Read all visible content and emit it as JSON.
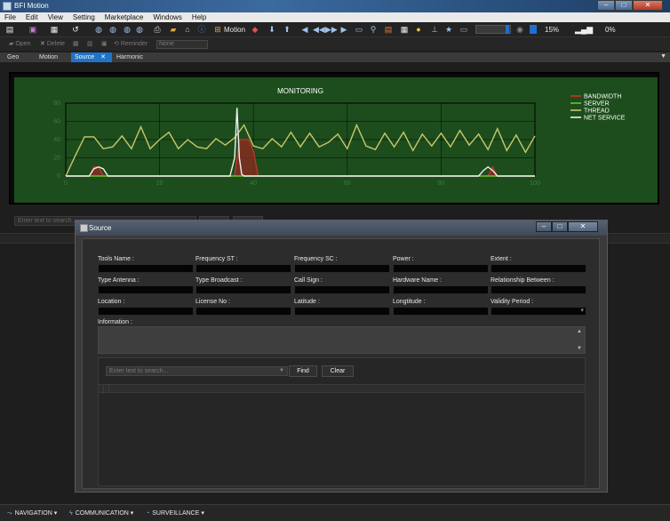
{
  "window": {
    "title": "BFI Motion",
    "min_icon": "minimize-icon",
    "max_icon": "maximize-icon",
    "close_icon": "close-icon"
  },
  "menu": [
    "File",
    "Edit",
    "View",
    "Setting",
    "Marketplace",
    "Windows",
    "Help"
  ],
  "toolbar": {
    "motion_label": "Motion",
    "zoom_value": "15%",
    "progress_value": "0%",
    "zoom_fill_percent": 15
  },
  "toolbar2": {
    "open_label": "Open",
    "delete_label": "Delete",
    "reminder_label": "Reminder",
    "reminder_select": "None"
  },
  "tabs": [
    "Geo",
    "Motion",
    "Source",
    "Harmonic"
  ],
  "active_tab": "Source",
  "tab_close": "✕",
  "chart_data": {
    "type": "line",
    "title": "MONITORING",
    "xlim": [
      0,
      100
    ],
    "ylim": [
      0,
      80
    ],
    "xticks": [
      "0",
      "20",
      "40",
      "60",
      "80",
      "100"
    ],
    "yticks": [
      "0",
      "20",
      "40",
      "60",
      "80"
    ],
    "grid": true,
    "legend_position": "right",
    "series": [
      {
        "name": "BANDWIDTH",
        "color": "#c0392b",
        "x": [
          5,
          6,
          7,
          8,
          36,
          37,
          39,
          40,
          41,
          90,
          91,
          92
        ],
        "y": [
          0,
          10,
          10,
          0,
          0,
          40,
          40,
          28,
          0,
          0,
          10,
          0
        ]
      },
      {
        "name": "SERVER",
        "color": "#6fbf3a",
        "x": [
          0,
          100
        ],
        "y": [
          0,
          0
        ]
      },
      {
        "name": "THREAD",
        "color": "#c8c86a",
        "x": [
          0,
          2,
          4,
          6,
          8,
          10,
          12,
          14,
          16,
          18,
          20,
          22,
          24,
          26,
          28,
          30,
          32,
          34,
          36,
          38,
          40,
          42,
          44,
          46,
          48,
          50,
          52,
          54,
          56,
          58,
          60,
          62,
          64,
          66,
          68,
          70,
          72,
          74,
          76,
          78,
          80,
          82,
          84,
          86,
          88,
          90,
          92,
          94,
          96,
          98,
          100
        ],
        "y": [
          0,
          22,
          43,
          43,
          30,
          32,
          44,
          30,
          54,
          30,
          40,
          48,
          30,
          40,
          32,
          30,
          41,
          34,
          42,
          56,
          33,
          30,
          41,
          32,
          48,
          32,
          47,
          32,
          37,
          46,
          30,
          56,
          33,
          29,
          47,
          32,
          48,
          28,
          46,
          33,
          47,
          32,
          50,
          34,
          46,
          29,
          52,
          28,
          45,
          26,
          44
        ]
      },
      {
        "name": "NET SERVICE",
        "color": "#f0f0f0",
        "x": [
          0,
          5,
          6,
          7,
          8,
          9,
          35,
          36,
          36.5,
          37,
          37.5,
          38,
          60,
          88,
          89,
          90,
          91,
          92,
          100
        ],
        "y": [
          0,
          0,
          8,
          10,
          8,
          0,
          0,
          20,
          75,
          20,
          2,
          0,
          0,
          0,
          6,
          10,
          6,
          0,
          0
        ]
      }
    ]
  },
  "background": {
    "search_placeholder": "Enter text to search..."
  },
  "dialog": {
    "title": "Source",
    "icon": "source-icon",
    "fields_row1": [
      "Tools Name :",
      "Frequency ST :",
      "Frequency SC :",
      "Power :",
      "Extent :"
    ],
    "fields_row2": [
      "Type Antenna :",
      "Type Broadcast :",
      "Call Sign :",
      "Hardware Name :",
      "Relationship Between :"
    ],
    "fields_row3": [
      "Location :",
      "License No :",
      "Latitude :",
      "Longtitude :",
      "Validity Period :"
    ],
    "information_label": "Information :",
    "search_placeholder": "Enter text to search...",
    "find_label": "Find",
    "clear_label": "Clear"
  },
  "bottom": {
    "navigation": "NAVIGATION ▾",
    "communication": "COMMUNICATION ▾",
    "surveillance": "SURVEILLANCE ▾"
  }
}
